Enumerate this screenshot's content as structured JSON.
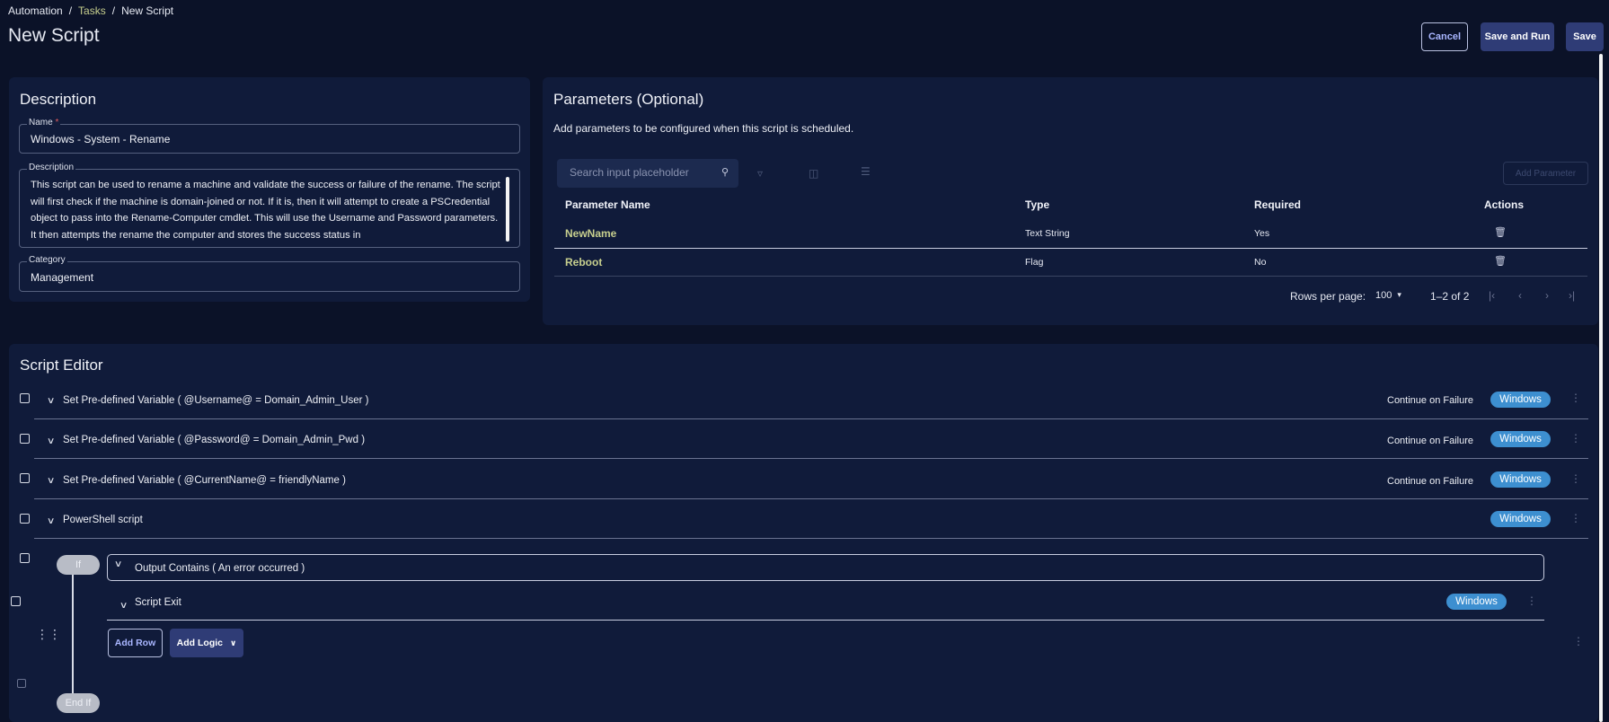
{
  "breadcrumb": {
    "root": "Automation",
    "sep": "/",
    "tasks": "Tasks",
    "current": "New Script"
  },
  "page_title": "New Script",
  "header_buttons": {
    "cancel": "Cancel",
    "save_and_run": "Save and Run",
    "save": "Save"
  },
  "description_card": {
    "title": "Description",
    "name_label": "Name",
    "required_mark": "*",
    "name_value": "Windows - System - Rename",
    "description_label": "Description",
    "description_value": "This script can be used to rename a machine and validate the success or failure of the rename. The script will first check if the machine is domain-joined or not. If it is, then it will attempt to create a PSCredential object to pass into the Rename-Computer cmdlet. This will use the Username and Password parameters. It then attempts the rename the computer and stores the success status in",
    "category_label": "Category",
    "category_value": "Management"
  },
  "parameters_card": {
    "title": "Parameters (Optional)",
    "subtitle": "Add parameters to be configured when this script is scheduled.",
    "search_placeholder": "Search input placeholder",
    "add_parameter": "Add Parameter",
    "columns": [
      "Parameter Name",
      "Type",
      "Required",
      "Actions"
    ],
    "rows": [
      {
        "name": "NewName",
        "type": "Text String",
        "required": "Yes"
      },
      {
        "name": "Reboot",
        "type": "Flag",
        "required": "No"
      }
    ],
    "rows_per_page_label": "Rows per page:",
    "rows_per_page_value": "100",
    "range": "1–2 of 2"
  },
  "script_editor": {
    "title": "Script Editor",
    "steps": [
      {
        "label": "Set Pre-defined Variable ( @Username@ = Domain_Admin_User )",
        "continue": "Continue on Failure",
        "os": "Windows"
      },
      {
        "label": "Set Pre-defined Variable ( @Password@ = Domain_Admin_Pwd )",
        "continue": "Continue on Failure",
        "os": "Windows"
      },
      {
        "label": "Set Pre-defined Variable ( @CurrentName@ = friendlyName )",
        "continue": "Continue on Failure",
        "os": "Windows"
      },
      {
        "label": "PowerShell script",
        "os": "Windows"
      }
    ],
    "if_label": "If",
    "condition": "Output Contains ( An error occurred )",
    "inner_step": {
      "label": "Script Exit",
      "os": "Windows"
    },
    "add_row": "Add Row",
    "add_logic": "Add Logic",
    "end_if": "End If"
  },
  "colors": {
    "background": "#0b1228",
    "card": "#101b3a",
    "accent": "#3d8fd0",
    "link": "#c7cf8e"
  }
}
